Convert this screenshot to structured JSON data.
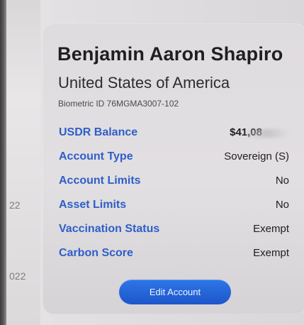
{
  "left_panel": {
    "year_fragment_1": "22",
    "year_fragment_2": "022"
  },
  "profile": {
    "name": "Benjamin Aaron Shapiro",
    "country": "United States of America",
    "biometric_id": "Biometric ID 76MGMA3007-102"
  },
  "details": [
    {
      "label": "USDR Balance",
      "value": "$41,08"
    },
    {
      "label": "Account Type",
      "value": "Sovereign (S)"
    },
    {
      "label": "Account Limits",
      "value": "No"
    },
    {
      "label": "Asset Limits",
      "value": "No"
    },
    {
      "label": "Vaccination Status",
      "value": "Exempt"
    },
    {
      "label": "Carbon Score",
      "value": "Exempt"
    }
  ],
  "actions": {
    "edit_account": "Edit Account"
  },
  "colors": {
    "accent_blue": "#2e5ec8",
    "button_blue": "#1d56ca"
  }
}
